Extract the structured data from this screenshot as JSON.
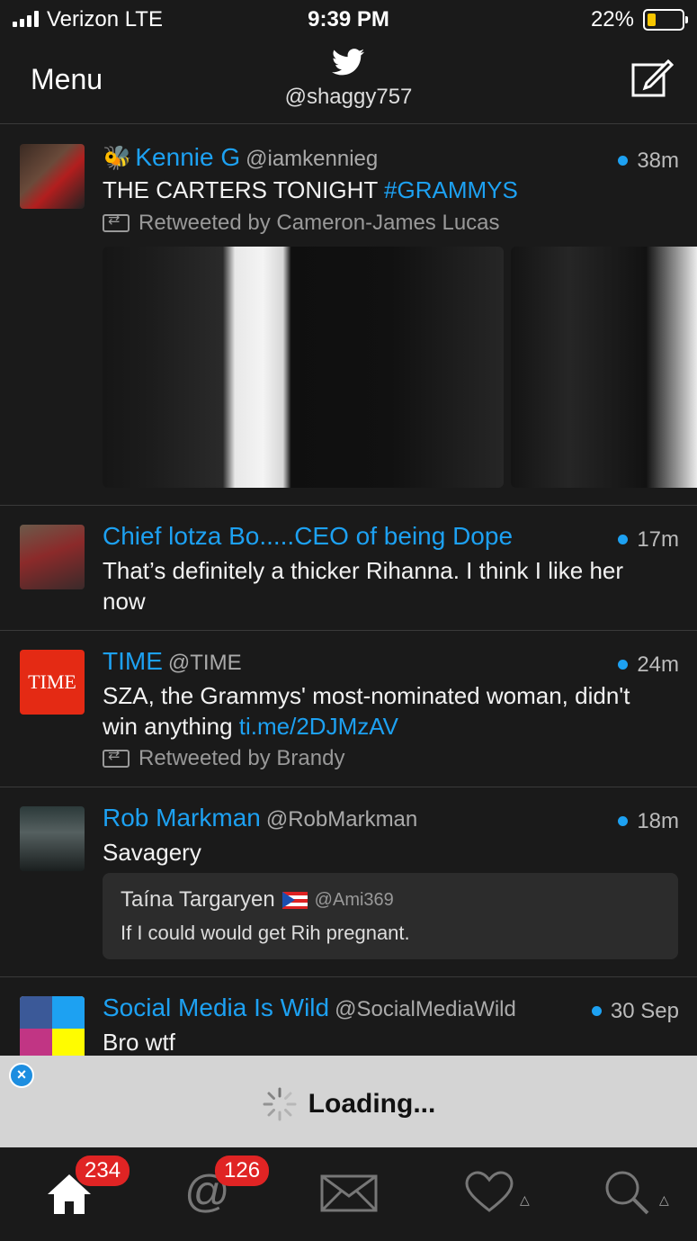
{
  "status": {
    "carrier": "Verizon  LTE",
    "time": "9:39 PM",
    "battery": "22%"
  },
  "nav": {
    "menu": "Menu",
    "handle": "@shaggy757"
  },
  "tweets": [
    {
      "name": "Kennie G",
      "handle": "@iamkennieg",
      "time": "38m",
      "text": "THE CARTERS TONIGHT ",
      "hashtag": "#GRAMMYS",
      "retweeted_by": "Retweeted by Cameron-James Lucas"
    },
    {
      "name": "Chief lotza Bo.....CEO of being Dope",
      "time": "17m",
      "text": "That’s definitely a thicker Rihanna. I think I like her now"
    },
    {
      "name": "TIME",
      "handle": "@TIME",
      "time": "24m",
      "text": "SZA, the Grammys' most-nominated woman, didn't win anything ",
      "link": "ti.me/2DJMzAV",
      "retweeted_by": "Retweeted by Brandy",
      "avatar_text": "TIME"
    },
    {
      "name": "Rob Markman",
      "handle": "@RobMarkman",
      "time": "18m",
      "text": "Savagery",
      "quote": {
        "name": "Taína Targaryen",
        "handle": "@Ami369",
        "text": "If I could would get Rih pregnant."
      }
    },
    {
      "name": "Social Media Is Wild",
      "handle": "@SocialMediaWild",
      "time": "30 Sep",
      "text": "Bro wtf"
    }
  ],
  "ad": {
    "loading": "Loading..."
  },
  "tabbar": {
    "home_badge": "234",
    "mentions_badge": "126"
  },
  "colors": {
    "accent": "#1da1f2",
    "badge": "#e02424",
    "background": "#1a1a1a"
  }
}
